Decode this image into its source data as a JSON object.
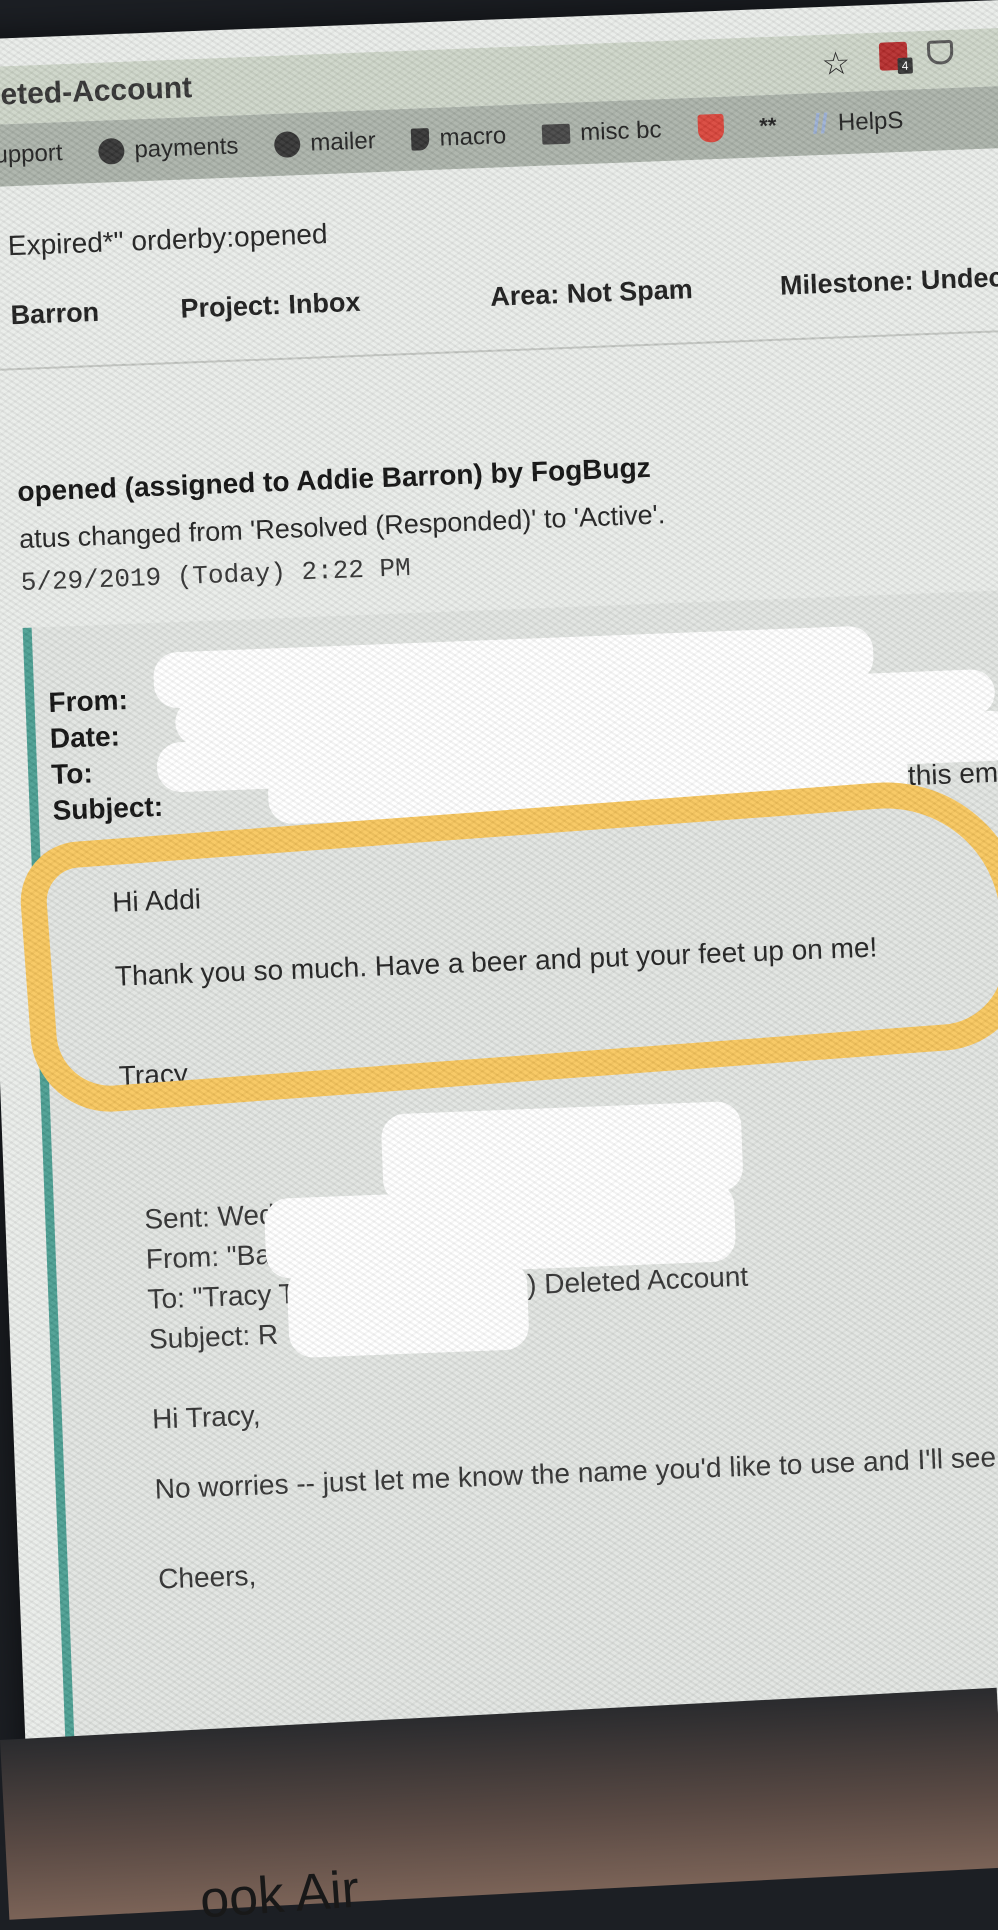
{
  "browser": {
    "url_fragment": "leted-Account",
    "extension_badge": "4"
  },
  "bookmarks": [
    {
      "label": "upport",
      "icon": "none"
    },
    {
      "label": "payments",
      "icon": "globe-icon"
    },
    {
      "label": "mailer",
      "icon": "globe-icon"
    },
    {
      "label": "macro",
      "icon": "tag-icon"
    },
    {
      "label": "misc bc",
      "icon": "folder-icon"
    },
    {
      "label": "",
      "icon": "shield-icon"
    },
    {
      "label": "**",
      "icon": "asterisk-icon"
    },
    {
      "label": "HelpS",
      "icon": "slash-icon"
    }
  ],
  "case": {
    "query": "Expired*\" orderby:opened",
    "assigned": "Barron",
    "project": "Project: Inbox",
    "area": "Area: Not Spam",
    "milestone": "Milestone: Undecided"
  },
  "event": {
    "title": "opened (assigned to Addie Barron) by FogBugz",
    "status": "atus changed from 'Resolved (Responded)' to 'Active'.",
    "time": "5/29/2019 (Today) 2:22 PM"
  },
  "email": {
    "from_label": "From:",
    "date_label": "Date:",
    "to_label": "To:",
    "subject_label": "Subject:",
    "subject_tail": "this email ac",
    "greeting": "Hi Addi",
    "thanks": "Thank you so much. Have a beer and put your feet up on me!",
    "signature": "Tracy",
    "quoted_sent": "Sent: Wednesday, May 2",
    "quoted_from": "From: \"Bar",
    "quoted_to": "To: \"Tracy Turle",
    "quoted_to_tail": ") Deleted Account",
    "quoted_subject": "Subject: R",
    "reply_greeting": "Hi Tracy,",
    "reply_body": "No worries -- just let me know the name you'd like to use and I'll see if",
    "reply_signoff": "Cheers,"
  },
  "device": {
    "bezel_label": "ook Air"
  },
  "colors": {
    "highlight": "#f8c65c",
    "email_border": "#4a9e92"
  }
}
